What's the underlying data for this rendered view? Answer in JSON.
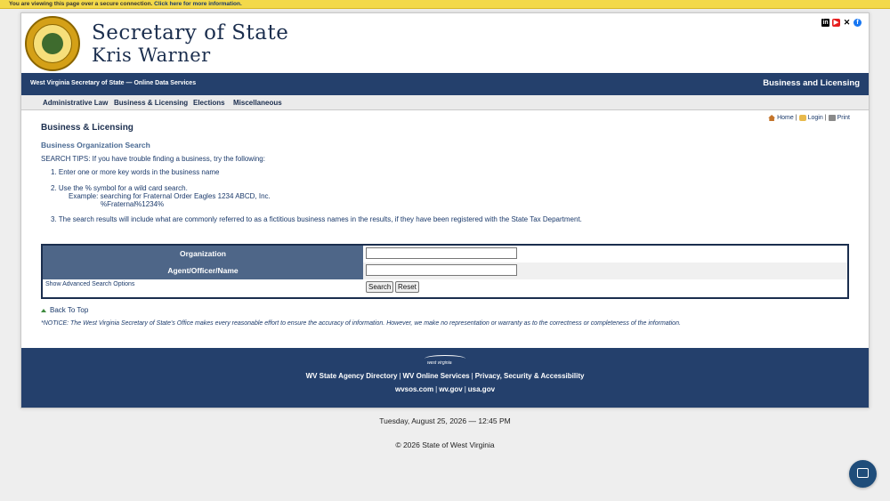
{
  "secure_notice": {
    "text": "You are viewing this page over a secure connection. ",
    "link": "Click here for more information."
  },
  "header": {
    "title_line1": "Secretary of State",
    "title_line2": "Kris Warner",
    "social_icons": [
      "linkedin-icon",
      "youtube-icon",
      "x-icon",
      "facebook-icon"
    ]
  },
  "bluebar": {
    "left": "West Virginia Secretary of State — Online Data Services",
    "right": "Business and Licensing"
  },
  "nav": [
    {
      "label": "Administrative Law"
    },
    {
      "label": "Business & Licensing"
    },
    {
      "label": "Elections"
    },
    {
      "label": "Miscellaneous"
    }
  ],
  "utility": {
    "home": "Home",
    "login": "Login",
    "print": "Print"
  },
  "content": {
    "heading": "Business & Licensing",
    "subheading": "Business Organization Search",
    "tips_intro": "SEARCH TIPS: If you have trouble finding a business, try the following:",
    "tip1": "1. Enter one or more key words in the business name",
    "tip2": "2. Use the % symbol for a wild card search.",
    "tip2_example": "Example: searching for Fraternal Order Eagles 1234 ABCD, Inc.",
    "tip2_example_value": "%Fraternal%1234%",
    "tip3": "3. The search results will include what are commonly referred to as a fictitious business names in the results, if they have been registered with the State Tax Department."
  },
  "form": {
    "org_label": "Organization",
    "org_value": "",
    "agent_label": "Agent/Officer/Name",
    "agent_value": "",
    "advanced_link": "Show Advanced Search Options",
    "search_button": "Search",
    "reset_button": "Reset"
  },
  "back_to_top": "Back To Top",
  "notice": "*NOTICE: The West Virginia Secretary of State's Office makes every reasonable effort to ensure the accuracy of information. However, we make no representation or warranty as to the correctness or completeness of the information.",
  "footer": {
    "logo_text": "west virginia",
    "links1": [
      "WV State Agency Directory",
      "WV Online Services",
      "Privacy, Security & Accessibility"
    ],
    "links2": [
      "wvsos.com",
      "wv.gov",
      "usa.gov"
    ],
    "separator": "|"
  },
  "datetime": "Tuesday, August 25, 2026 — 12:45 PM",
  "copyright": "© 2026 State of West Virginia"
}
